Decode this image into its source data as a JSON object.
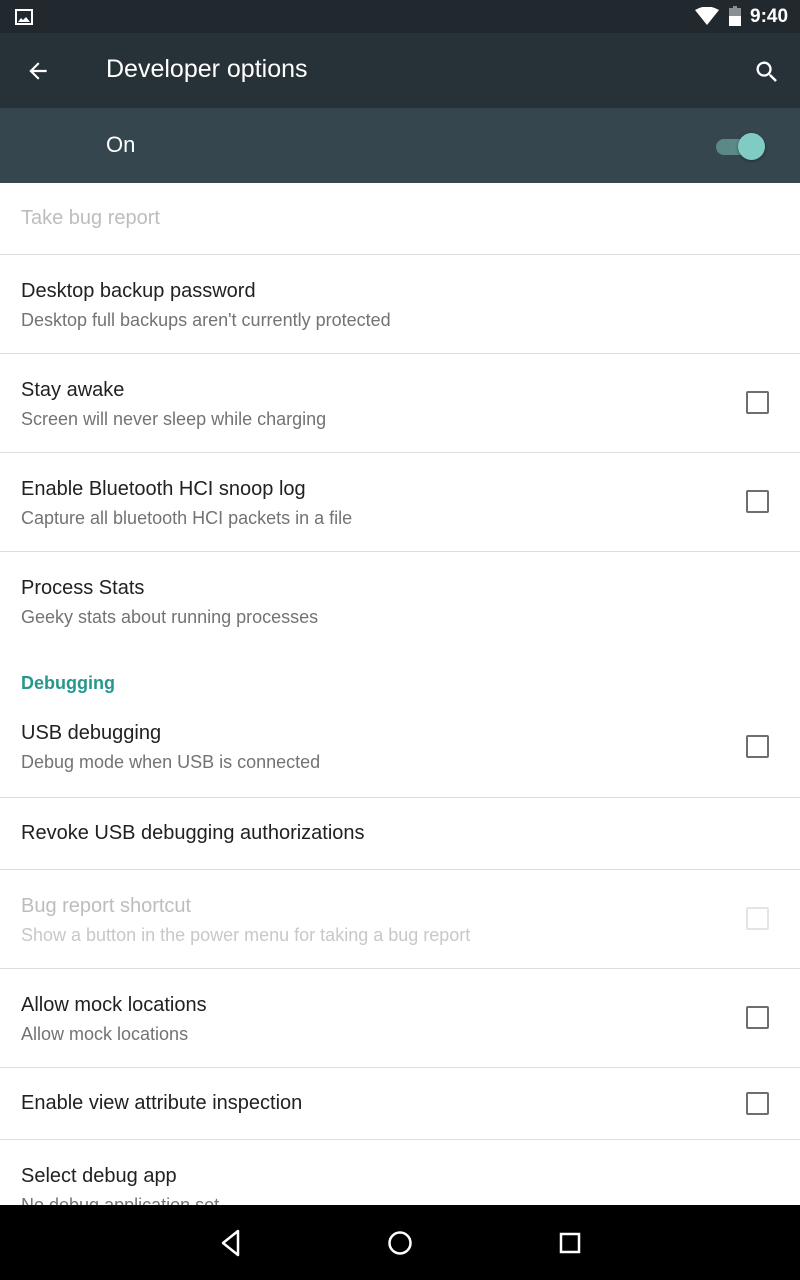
{
  "status_bar": {
    "time": "9:40",
    "icons": [
      "image-notification-icon",
      "wifi-icon",
      "battery-icon"
    ]
  },
  "toolbar": {
    "title": "Developer options",
    "back_icon": "arrow-back-icon",
    "search_icon": "search-icon"
  },
  "master_switch": {
    "label": "On",
    "checked": true
  },
  "colors": {
    "status_bar_bg": "#22292e",
    "toolbar_bg": "#273238",
    "switch_bar_bg": "#36464f",
    "accent": "#80cbc4",
    "category_text": "#26978b",
    "divider": "#dedede"
  },
  "preferences": {
    "take_bug_report": {
      "title": "Take bug report",
      "enabled": false
    },
    "desktop_backup_password": {
      "title": "Desktop backup password",
      "summary": "Desktop full backups aren't currently protected"
    },
    "stay_awake": {
      "title": "Stay awake",
      "summary": "Screen will never sleep while charging",
      "checked": false
    },
    "bt_hci_snoop": {
      "title": "Enable Bluetooth HCI snoop log",
      "summary": "Capture all bluetooth HCI packets in a file",
      "checked": false
    },
    "process_stats": {
      "title": "Process Stats",
      "summary": "Geeky stats about running processes"
    }
  },
  "debugging": {
    "category_title": "Debugging",
    "usb_debugging": {
      "title": "USB debugging",
      "summary": "Debug mode when USB is connected",
      "checked": false
    },
    "revoke_usb": {
      "title": "Revoke USB debugging authorizations"
    },
    "bug_report_shortcut": {
      "title": "Bug report shortcut",
      "summary": "Show a button in the power menu for taking a bug report",
      "checked": false,
      "enabled": false
    },
    "mock_locations": {
      "title": "Allow mock locations",
      "summary": "Allow mock locations",
      "checked": false
    },
    "view_attr_inspection": {
      "title": "Enable view attribute inspection",
      "checked": false
    },
    "select_debug_app": {
      "title": "Select debug app",
      "summary": "No debug application set"
    }
  },
  "nav_bar": {
    "back_icon": "nav-back-icon",
    "home_icon": "nav-home-icon",
    "recents_icon": "nav-recents-icon"
  }
}
